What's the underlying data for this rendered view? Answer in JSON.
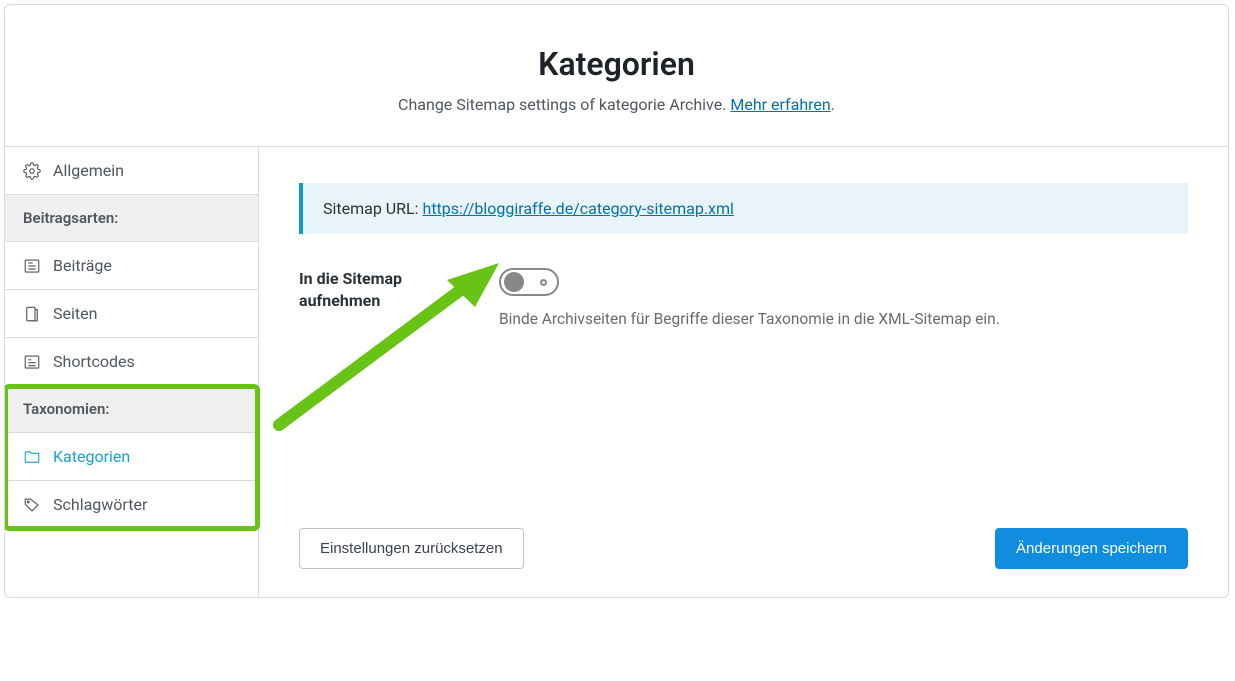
{
  "header": {
    "title": "Kategorien",
    "subtitle_prefix": "Change Sitemap settings of kategorie Archive. ",
    "learn_more": "Mehr erfahren",
    "subtitle_suffix": "."
  },
  "sidebar": {
    "general": "Allgemein",
    "section_posts": "Beitragsarten:",
    "posts": "Beiträge",
    "pages": "Seiten",
    "shortcodes": "Shortcodes",
    "section_taxonomies": "Taxonomien:",
    "categories": "Kategorien",
    "tags": "Schlagwörter"
  },
  "main": {
    "sitemap_url_label": "Sitemap URL: ",
    "sitemap_url": "https://bloggiraffe.de/category-sitemap.xml",
    "include_label": "In die Sitemap aufnehmen",
    "include_desc": "Binde Archivseiten für Begriffe dieser Taxonomie in die XML-Sitemap ein.",
    "toggle_state": false
  },
  "footer": {
    "reset": "Einstellungen zurücksetzen",
    "save": "Änderungen speichern"
  },
  "annotation": {
    "arrow_color": "#68c315"
  }
}
